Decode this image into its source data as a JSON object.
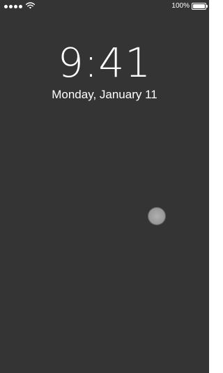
{
  "status_bar": {
    "signal_icon": "signal-dots-icon",
    "wifi_icon": "wifi-icon",
    "battery_percent": "100%",
    "battery_icon": "battery-icon",
    "battery_level": 1.0
  },
  "lock_screen": {
    "time": "9:41",
    "date": "Monday, January 11"
  },
  "overlay": {
    "touch_indicator_icon": "touch-indicator"
  },
  "colors": {
    "background": "#343434",
    "foreground": "#ffffff"
  }
}
